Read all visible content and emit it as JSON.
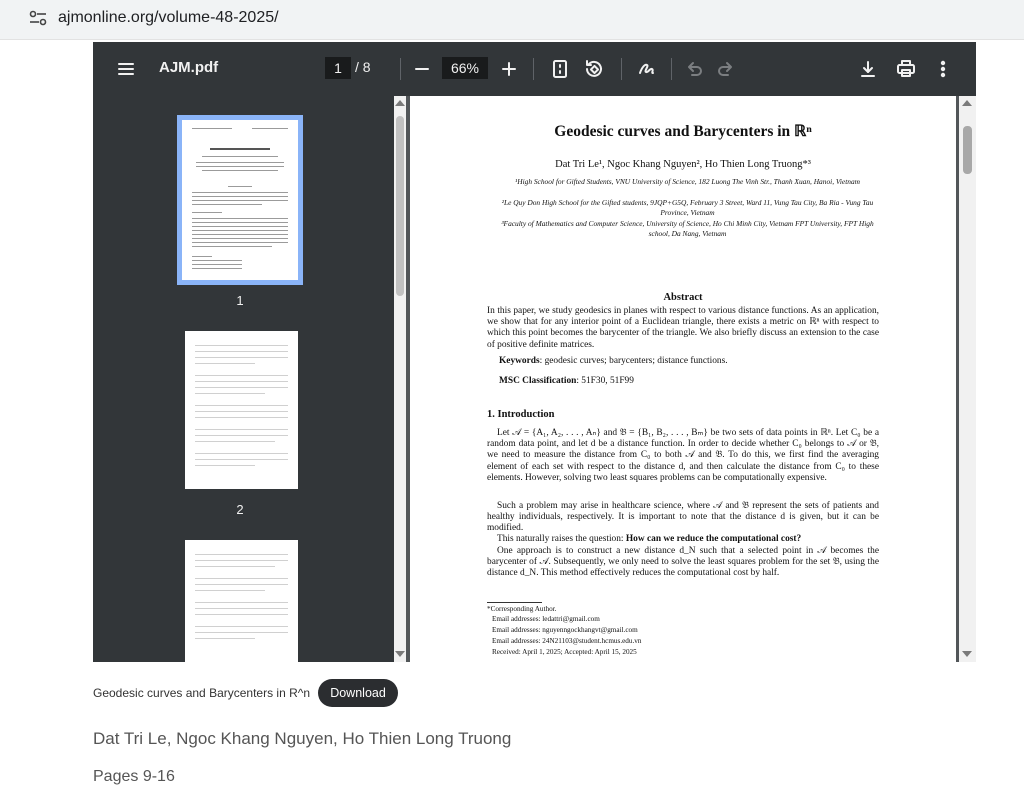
{
  "browser": {
    "url": "ajmonline.org/volume-48-2025/"
  },
  "viewer": {
    "filename": "AJM.pdf",
    "current_page": "1",
    "page_separator": "/",
    "total_pages": "8",
    "zoom": "66%",
    "icons": [
      "menu-icon",
      "zoom-out-icon",
      "zoom-in-icon",
      "fit-page-icon",
      "rotate-icon",
      "annotate-icon",
      "undo-icon",
      "redo-icon",
      "download-icon",
      "print-icon",
      "more-icon"
    ]
  },
  "sidebar": {
    "thumbnails": [
      {
        "label": "1"
      },
      {
        "label": "2"
      }
    ]
  },
  "paper": {
    "title": "Geodesic curves and Barycenters in ℝⁿ",
    "authors": "Dat Tri Le¹, Ngoc Khang Nguyen², Ho Thien Long Truong*³",
    "affiliations": [
      "¹High School for Gifted Students, VNU University of Science, 182 Luong The Vinh Str., Thanh Xuan, Hanoi, Vietnam",
      "²Le Quy Don High School for the Gifted students, 9JQP+G5Q, February 3 Street, Ward 11, Vung Tau City, Ba Ria - Vung Tau Province, Vietnam",
      "³Faculty of Mathematics and Computer Science, University of Science, Ho Chi Minh City, Vietnam FPT University, FPT High school, Da Nang, Vietnam"
    ],
    "abstract_heading": "Abstract",
    "abstract": "In this paper, we study geodesics in planes with respect to various distance functions. As an application, we show that for any interior point of a Euclidean triangle, there exists a metric on ℝⁿ with respect to which this point becomes the barycenter of the triangle. We also briefly discuss an extension to the case of positive definite matrices.",
    "keywords_label": "Keywords",
    "keywords": ": geodesic curves; barycenters; distance functions.",
    "msc_label": "MSC Classification",
    "msc": ": 51F30, 51F99",
    "section_heading": "1. Introduction",
    "intro_p1": "Let 𝒜 = {A₁, A₂, . . . , Aₙ} and 𝔅 = {B₁, B₂, . . . , Bₘ} be two sets of data points in ℝⁿ. Let C₀ be a random data point, and let d be a distance function. In order to decide whether C₀ belongs to 𝒜 or 𝔅, we need to measure the distance from C₀ to both 𝒜 and 𝔅. To do this, we first find the averaging element of each set with respect to the distance d, and then calculate the distance from C₀ to these elements. However, solving two least squares problems can be computationally expensive.",
    "intro_p2": "Such a problem may arise in healthcare science, where 𝒜 and 𝔅 represent the sets of patients and healthy individuals, respectively. It is important to note that the distance d is given, but it can be modified.",
    "intro_p3_pre": "This naturally raises the question: ",
    "intro_p3_bold": "How can we reduce the computational cost?",
    "intro_p4": "One approach is to construct a new distance d_N such that a selected point in 𝒜 becomes the barycenter of 𝒜. Subsequently, we only need to solve the least squares problem for the set 𝔅, using the distance d_N. This method effectively reduces the computational cost by half.",
    "footnotes": [
      "*Corresponding Author.",
      "Email addresses: ledattri@gmail.com",
      "Email addresses: nguyenngockhangvt@gmail.com",
      "Email addresses: 24N21103@student.hcmus.edu.vn",
      "Received: April 1, 2025; Accepted: April 15, 2025"
    ]
  },
  "article": {
    "title": "Geodesic curves and Barycenters in R^n",
    "download_label": "Download",
    "authors": "Dat Tri Le, Ngoc Khang Nguyen, Ho Thien Long Truong",
    "pages": "Pages 9-16"
  }
}
